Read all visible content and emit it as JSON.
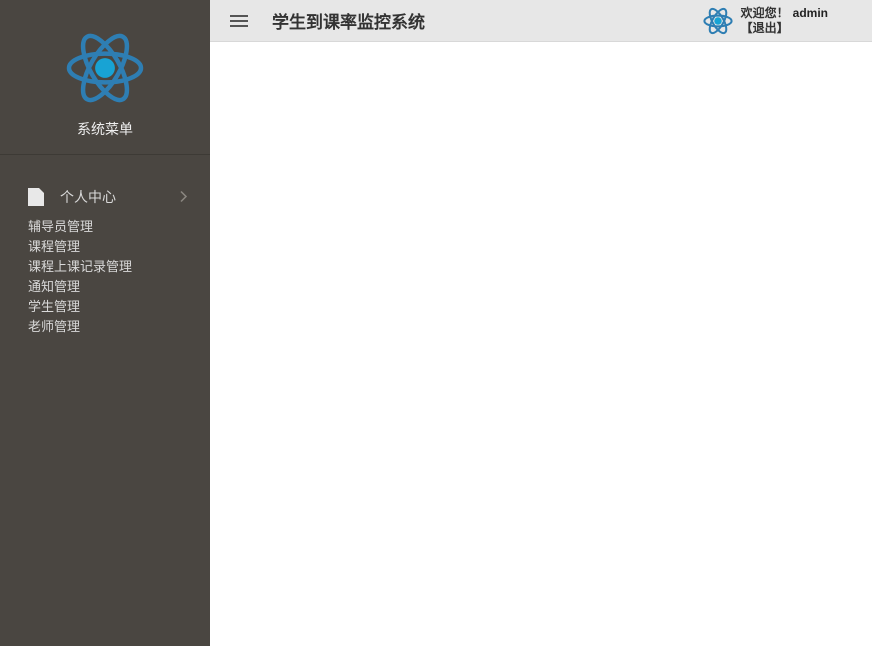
{
  "sidebar": {
    "title": "系统菜单",
    "primary": {
      "label": "个人中心"
    },
    "items": [
      {
        "label": "辅导员管理"
      },
      {
        "label": "课程管理"
      },
      {
        "label": "课程上课记录管理"
      },
      {
        "label": "通知管理"
      },
      {
        "label": "学生管理"
      },
      {
        "label": "老师管理"
      }
    ]
  },
  "header": {
    "app_title": "学生到课率监控系统",
    "welcome": "欢迎您！",
    "username": "admin",
    "logout": "【退出】"
  }
}
